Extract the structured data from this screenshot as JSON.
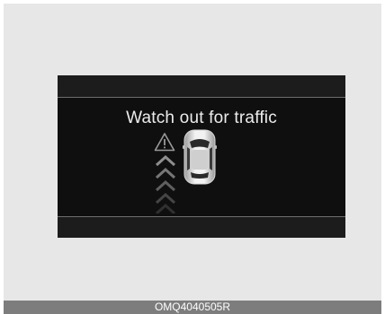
{
  "display": {
    "message": "Watch out for traffic"
  },
  "icons": {
    "warning": "warning-triangle-icon",
    "car": "car-top-view-icon",
    "approach": "approaching-chevrons-icon"
  },
  "caption": {
    "code": "OMQ4040505R"
  },
  "colors": {
    "screen_background": "#0f0f0f",
    "text": "#ececec",
    "caption_bar": "#7d7d7d"
  }
}
